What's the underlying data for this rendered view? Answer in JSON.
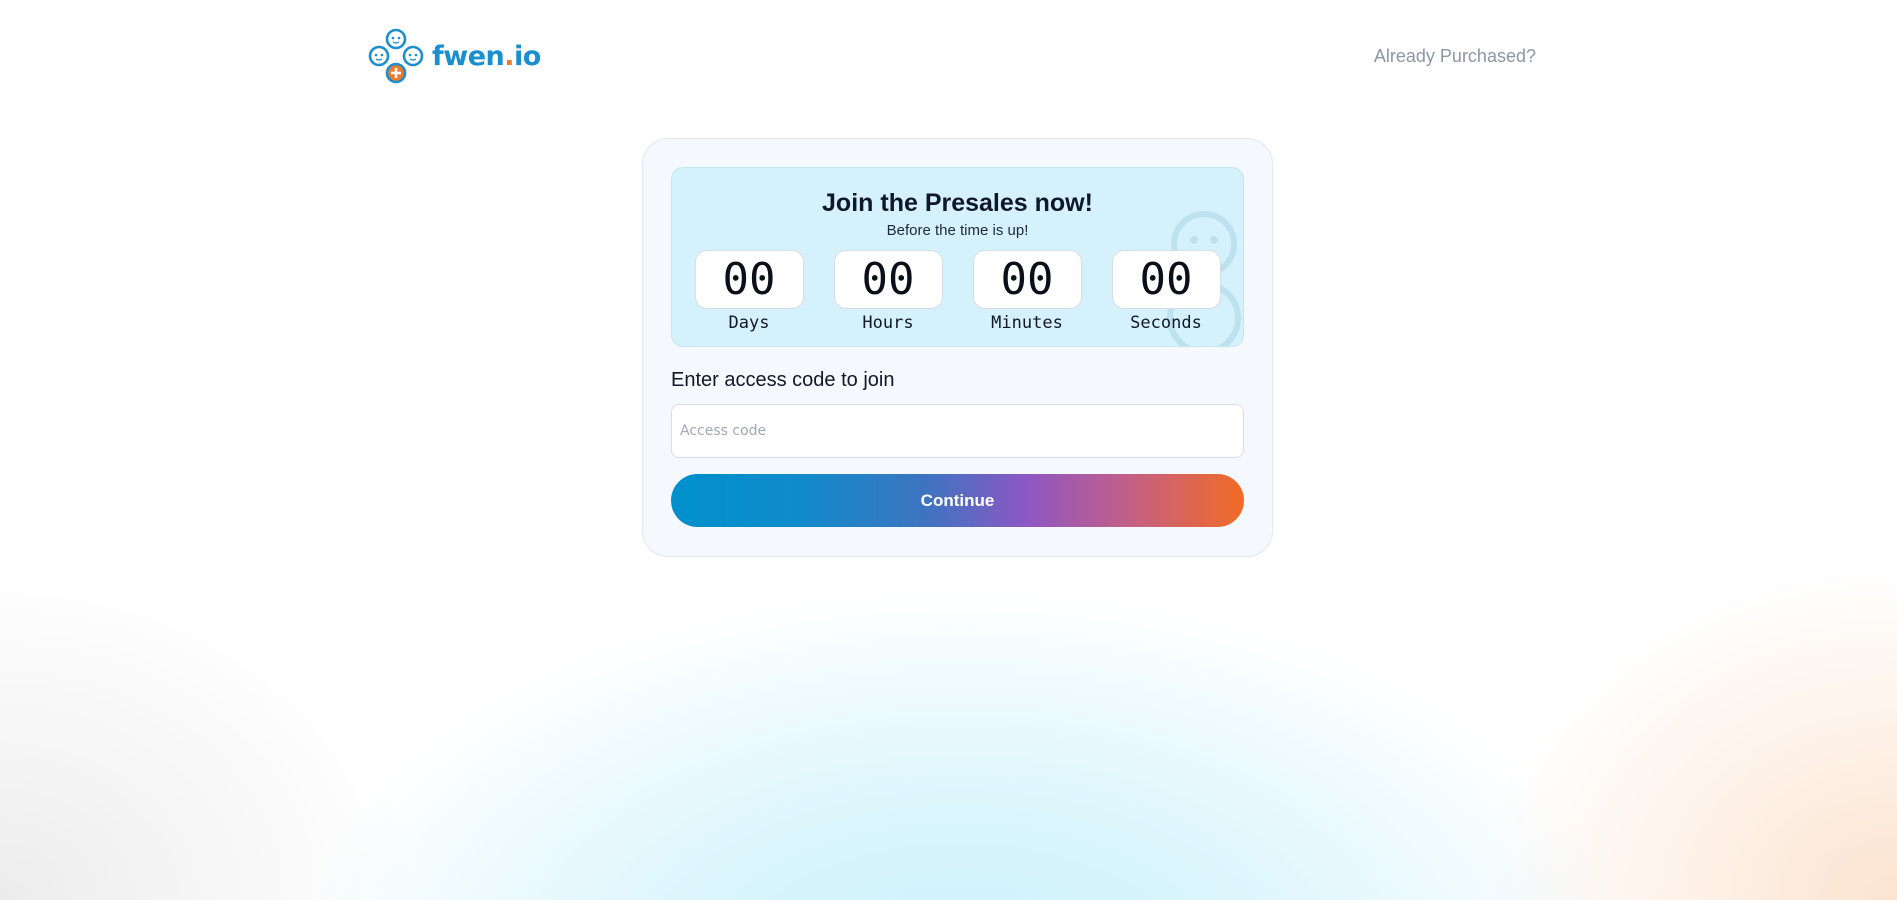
{
  "header": {
    "logo": {
      "text_main": "fwen",
      "text_dot": ".",
      "text_tld": "io"
    },
    "already_purchased": "Already Purchased?"
  },
  "presale": {
    "title": "Join the Presales now!",
    "subtitle": "Before the time is up!",
    "countdown": [
      {
        "value": "00",
        "label": "Days"
      },
      {
        "value": "00",
        "label": "Hours"
      },
      {
        "value": "00",
        "label": "Minutes"
      },
      {
        "value": "00",
        "label": "Seconds"
      }
    ]
  },
  "access": {
    "label": "Enter access code to join",
    "input_placeholder": "Access code",
    "input_value": "",
    "continue_label": "Continue"
  },
  "colors": {
    "brand_blue": "#1a8fcf",
    "brand_orange": "#f07a2a",
    "timer_bg": "#d5f1fb",
    "button_gradient_start": "#0090cc",
    "button_gradient_mid": "#8d57c4",
    "button_gradient_end": "#f26b24"
  },
  "icons": {
    "logo": "fwen-cluster-logo-icon",
    "mascot": "fwen-mascot-icon"
  }
}
